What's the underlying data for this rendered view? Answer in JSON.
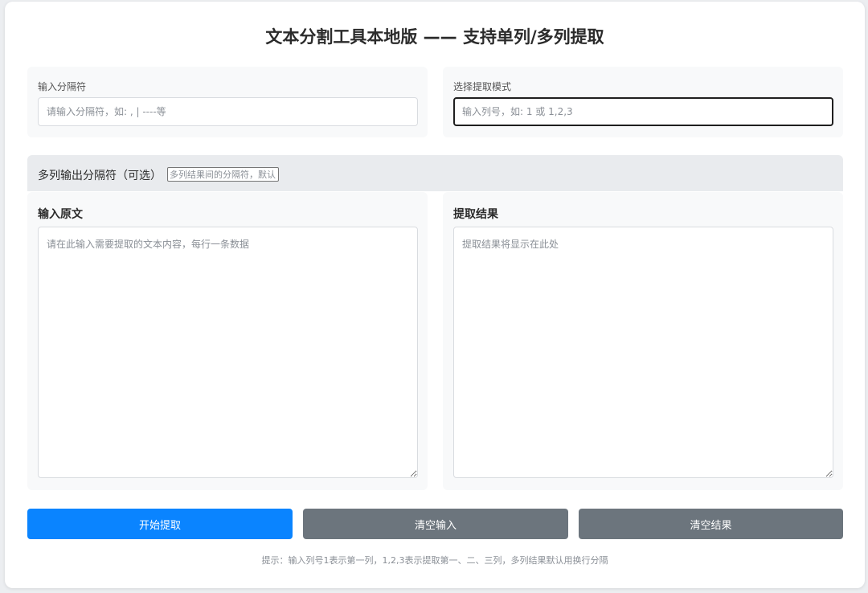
{
  "title": "文本分割工具本地版 —— 支持单列/多列提取",
  "separator": {
    "label": "输入分隔符",
    "placeholder": "请输入分隔符，如: , | ----等",
    "value": ""
  },
  "mode": {
    "label": "选择提取模式",
    "placeholder": "输入列号，如: 1 或 1,2,3",
    "value": ""
  },
  "multi_output": {
    "label": "多列输出分隔符（可选）",
    "placeholder": "多列结果间的分隔符，默认",
    "value": ""
  },
  "input_area": {
    "label": "输入原文",
    "placeholder": "请在此输入需要提取的文本内容，每行一条数据",
    "value": ""
  },
  "output_area": {
    "label": "提取结果",
    "placeholder": "提取结果将显示在此处",
    "value": ""
  },
  "buttons": {
    "start": "开始提取",
    "clear_input": "清空输入",
    "clear_result": "清空结果"
  },
  "hint": "提示：输入列号1表示第一列，1,2,3表示提取第一、二、三列，多列结果默认用换行分隔",
  "colors": {
    "primary": "#0a84ff",
    "secondary": "#6c757d",
    "panel_bg": "#f8f9fa"
  }
}
